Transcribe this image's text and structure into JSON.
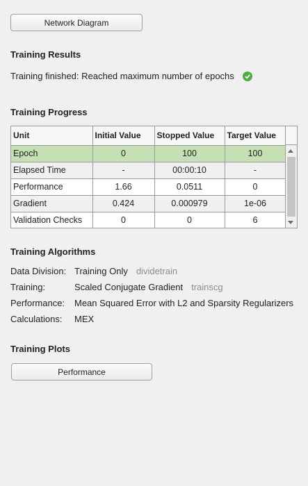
{
  "buttons": {
    "network_diagram": "Network Diagram",
    "performance": "Performance"
  },
  "results": {
    "title": "Training Results",
    "status": "Training finished: Reached maximum number of epochs"
  },
  "progress": {
    "title": "Training Progress",
    "columns": [
      "Unit",
      "Initial Value",
      "Stopped Value",
      "Target Value"
    ],
    "rows": [
      {
        "unit": "Epoch",
        "initial": "0",
        "stopped": "100",
        "target": "100",
        "selected": true
      },
      {
        "unit": "Elapsed Time",
        "initial": "-",
        "stopped": "00:00:10",
        "target": "-"
      },
      {
        "unit": "Performance",
        "initial": "1.66",
        "stopped": "0.0511",
        "target": "0"
      },
      {
        "unit": "Gradient",
        "initial": "0.424",
        "stopped": "0.000979",
        "target": "1e-06"
      },
      {
        "unit": "Validation Checks",
        "initial": "0",
        "stopped": "0",
        "target": "6"
      }
    ]
  },
  "algorithms": {
    "title": "Training Algorithms",
    "items": [
      {
        "label": "Data Division:",
        "value": "Training Only",
        "fn": "dividetrain"
      },
      {
        "label": "Training:",
        "value": "Scaled Conjugate Gradient",
        "fn": "trainscg"
      },
      {
        "label": "Performance:",
        "value": "Mean Squared Error with L2 and Sparsity Regularizers",
        "fn": ""
      },
      {
        "label": "Calculations:",
        "value": "MEX",
        "fn": ""
      }
    ]
  },
  "plots": {
    "title": "Training Plots"
  },
  "colors": {
    "selected_row": "#c5e0b4",
    "success": "#4caf3f"
  }
}
